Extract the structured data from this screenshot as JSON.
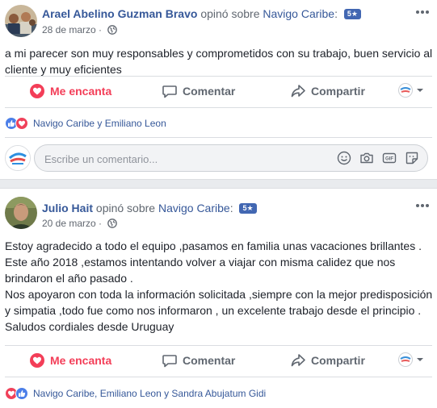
{
  "posts": [
    {
      "author": "Arael Abelino Guzman Bravo",
      "reviewed_text": "opinó sobre",
      "page_name": "Navigo Caribe",
      "colon": ":",
      "rating_badge": "5★",
      "date": "28 de marzo",
      "date_sep": "·",
      "text": "a mi parecer son muy responsables y comprometidos con su trabajo, buen servicio al cliente y muy eficientes",
      "actions": {
        "love": "Me encanta",
        "comment": "Comentar",
        "share": "Compartir"
      },
      "reactions": {
        "names": "Navigo Caribe y Emiliano Leon",
        "order": [
          "like",
          "love"
        ]
      }
    },
    {
      "author": "Julio Hait",
      "reviewed_text": "opinó sobre",
      "page_name": "Navigo Caribe",
      "colon": ":",
      "rating_badge": "5★",
      "date": "20 de marzo",
      "date_sep": "·",
      "text_lines": [
        "Estoy agradecido a todo el equipo ,pasamos en familia unas vacaciones brillantes .",
        "Este año 2018 ,estamos intentando volver a viajar con misma calidez que nos brindaron el año pasado .",
        "Nos apoyaron con toda la información solicitada ,siempre con la mejor predisposición y simpatia ,todo fue como nos informaron , un excelente trabajo desde el principio .",
        "Saludos cordiales desde Uruguay"
      ],
      "actions": {
        "love": "Me encanta",
        "comment": "Comentar",
        "share": "Compartir"
      },
      "reactions": {
        "names": "Navigo Caribe, Emiliano Leon y Sandra Abujatum Gidi",
        "order": [
          "love",
          "like"
        ]
      }
    }
  ],
  "comment_box": {
    "placeholder": "Escribe un comentario..."
  },
  "icons": {
    "globe": "globe-icon",
    "more": "more-options-icon",
    "love": "heart-icon",
    "comment": "comment-bubble-icon",
    "share": "share-arrow-icon",
    "emoji": "emoji-icon",
    "camera": "camera-icon",
    "gif": "gif-icon",
    "sticker": "sticker-icon"
  },
  "colors": {
    "link": "#365899",
    "love": "#f33e58",
    "like": "#4c7fe8",
    "muted": "#606770",
    "badge": "#4267b2"
  }
}
